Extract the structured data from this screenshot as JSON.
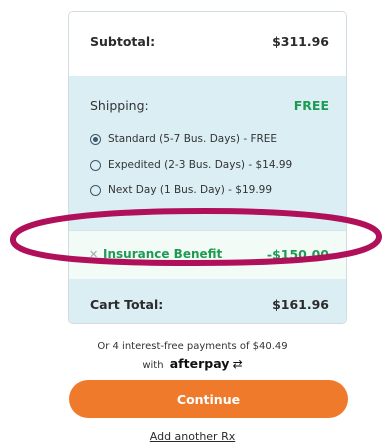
{
  "summary": {
    "subtotal_label": "Subtotal:",
    "subtotal_value": "$311.96"
  },
  "shipping": {
    "label": "Shipping:",
    "status": "FREE",
    "options": [
      {
        "label": "Standard (5-7 Bus. Days) - FREE",
        "selected": true
      },
      {
        "label": "Expedited (2-3 Bus. Days) - $14.99",
        "selected": false
      },
      {
        "label": "Next Day (1 Bus. Day) - $19.99",
        "selected": false
      }
    ]
  },
  "insurance": {
    "remove_icon": "close-icon",
    "label": "Insurance Benefit",
    "value": "-$150.00"
  },
  "total": {
    "label": "Cart Total:",
    "value": "$161.96"
  },
  "afterpay": {
    "line1": "Or 4 interest-free payments of $40.49",
    "with": "with",
    "brand": "afterpay",
    "icon": "afterpay-arrows-icon"
  },
  "actions": {
    "continue_label": "Continue",
    "add_rx_label": "Add another Rx"
  },
  "colors": {
    "accent_orange": "#f07a2c",
    "green": "#1e9b52",
    "panel_blue": "#daeef4",
    "highlight_ellipse": "#b0105a"
  }
}
